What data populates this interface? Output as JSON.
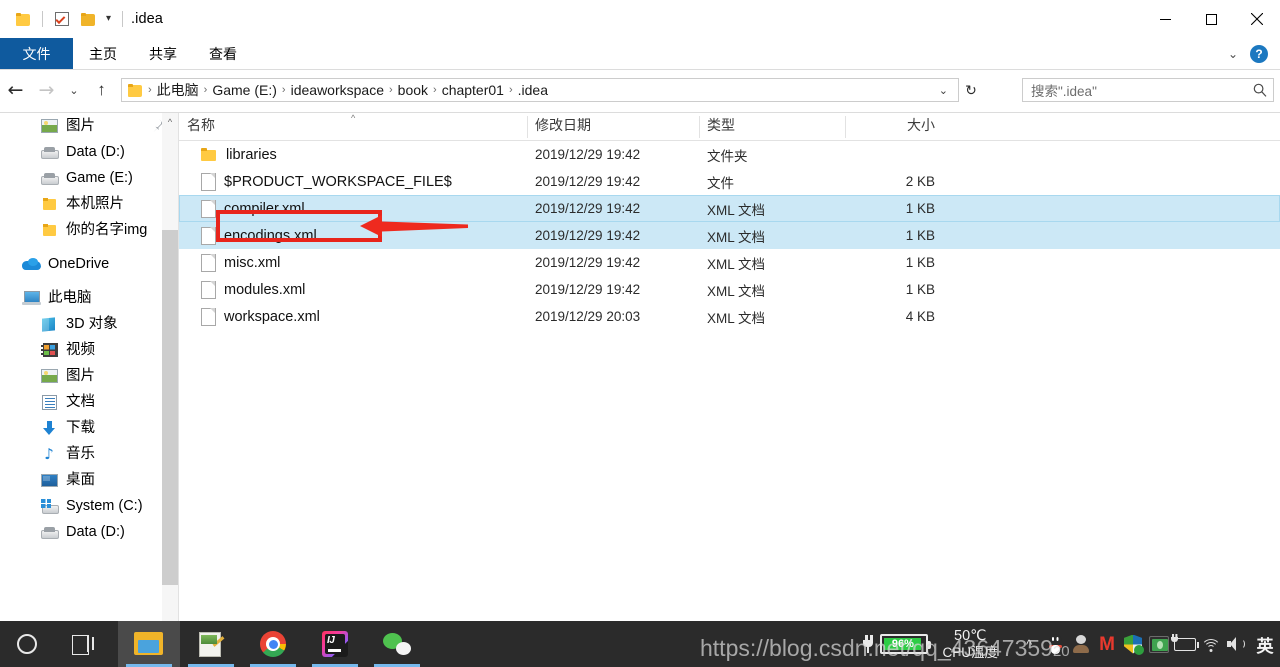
{
  "window": {
    "title": ".idea",
    "quick_access": [
      "folder-icon",
      "properties-checkbox-icon",
      "new-folder-icon",
      "customize-caret-icon"
    ],
    "controls": {
      "minimize": "–",
      "maximize": "□",
      "close": "×"
    }
  },
  "ribbon": {
    "tabs": [
      {
        "id": "file",
        "label": "文件"
      },
      {
        "id": "home",
        "label": "主页"
      },
      {
        "id": "share",
        "label": "共享"
      },
      {
        "id": "view",
        "label": "查看"
      }
    ],
    "active_tab": "file",
    "expand_caret": "⌄",
    "help_label": "?"
  },
  "navigation": {
    "back": "←",
    "forward": "→",
    "recent": "⌄",
    "up": "↑",
    "breadcrumb": [
      "此电脑",
      "Game (E:)",
      "ideaworkspace",
      "book",
      "chapter01",
      ".idea"
    ],
    "breadcrumb_separator": "›",
    "address_caret": "⌄",
    "refresh": "↻"
  },
  "search": {
    "placeholder": "搜索\".idea\"",
    "icon": "search-icon"
  },
  "sidebar": {
    "items": [
      {
        "label": "图片",
        "icon": "picture-icon",
        "indent": 1,
        "pinned": true
      },
      {
        "label": "Data (D:)",
        "icon": "drive-icon",
        "indent": 1,
        "pinned": false
      },
      {
        "label": "Game (E:)",
        "icon": "drive-icon",
        "indent": 1,
        "pinned": false
      },
      {
        "label": "本机照片",
        "icon": "folder-icon",
        "indent": 1,
        "pinned": false
      },
      {
        "label": "你的名字img",
        "icon": "folder-icon",
        "indent": 1,
        "pinned": false
      },
      {
        "label": "OneDrive",
        "icon": "onedrive-icon",
        "indent": 0,
        "pinned": false
      },
      {
        "label": "此电脑",
        "icon": "this-pc-icon",
        "indent": 0,
        "pinned": false
      },
      {
        "label": "3D 对象",
        "icon": "3d-objects-icon",
        "indent": 1,
        "pinned": false
      },
      {
        "label": "视频",
        "icon": "videos-icon",
        "indent": 1,
        "pinned": false
      },
      {
        "label": "图片",
        "icon": "pictures-icon",
        "indent": 1,
        "pinned": false
      },
      {
        "label": "文档",
        "icon": "documents-icon",
        "indent": 1,
        "pinned": false
      },
      {
        "label": "下载",
        "icon": "downloads-icon",
        "indent": 1,
        "pinned": false
      },
      {
        "label": "音乐",
        "icon": "music-icon",
        "indent": 1,
        "pinned": false
      },
      {
        "label": "桌面",
        "icon": "desktop-icon",
        "indent": 1,
        "pinned": false
      },
      {
        "label": "System (C:)",
        "icon": "system-drive-icon",
        "indent": 1,
        "pinned": false
      },
      {
        "label": "Data (D:)",
        "icon": "drive-icon",
        "indent": 1,
        "pinned": false
      }
    ],
    "scroll_up_glyph": "^"
  },
  "file_list": {
    "columns": [
      {
        "id": "name",
        "label": "名称"
      },
      {
        "id": "date",
        "label": "修改日期"
      },
      {
        "id": "type",
        "label": "类型"
      },
      {
        "id": "size",
        "label": "大小"
      }
    ],
    "sort_indicator": "^",
    "rows": [
      {
        "name": "libraries",
        "date": "2019/12/29 19:42",
        "type": "文件夹",
        "size": "",
        "icon": "folder-icon",
        "selected": false,
        "focused": false
      },
      {
        "name": "$PRODUCT_WORKSPACE_FILE$",
        "date": "2019/12/29 19:42",
        "type": "文件",
        "size": "2 KB",
        "icon": "file-icon",
        "selected": false,
        "focused": false
      },
      {
        "name": "compiler.xml",
        "date": "2019/12/29 19:42",
        "type": "XML 文档",
        "size": "1 KB",
        "icon": "file-icon",
        "selected": true,
        "focused": true
      },
      {
        "name": "encodings.xml",
        "date": "2019/12/29 19:42",
        "type": "XML 文档",
        "size": "1 KB",
        "icon": "file-icon",
        "selected": true,
        "focused": false
      },
      {
        "name": "misc.xml",
        "date": "2019/12/29 19:42",
        "type": "XML 文档",
        "size": "1 KB",
        "icon": "file-icon",
        "selected": false,
        "focused": false
      },
      {
        "name": "modules.xml",
        "date": "2019/12/29 19:42",
        "type": "XML 文档",
        "size": "1 KB",
        "icon": "file-icon",
        "selected": false,
        "focused": false
      },
      {
        "name": "workspace.xml",
        "date": "2019/12/29 20:03",
        "type": "XML 文档",
        "size": "4 KB",
        "icon": "file-icon",
        "selected": false,
        "focused": false
      }
    ]
  },
  "annotation": {
    "color": "#e8251c",
    "target_row": "compiler.xml",
    "shape": "rectangle-with-left-arrow"
  },
  "taskbar": {
    "start": "start-orb-icon",
    "cortana": "cortana-circle-icon",
    "task_view": "task-view-icon",
    "apps": [
      {
        "name": "file-explorer",
        "icon": "explorer-icon",
        "active": true,
        "running": true
      },
      {
        "name": "notepad-plus",
        "icon": "notepad-icon",
        "active": false,
        "running": true
      },
      {
        "name": "google-chrome",
        "icon": "chrome-icon",
        "active": false,
        "running": true
      },
      {
        "name": "intellij-idea",
        "icon": "intellij-idea-icon",
        "active": false,
        "running": true
      },
      {
        "name": "wechat",
        "icon": "wechat-icon",
        "active": false,
        "running": true
      }
    ],
    "tray": {
      "battery_percent": "96%",
      "cpu_temp_value": "50℃",
      "cpu_temp_label": "CPU温度",
      "chevron": "^",
      "icons": [
        "qq-icon",
        "head-icon",
        "m-icon",
        "security-shield-icon",
        "money-icon",
        "battery-icon",
        "wifi-icon",
        "volume-icon"
      ],
      "ime": "英"
    }
  },
  "watermark": {
    "text": "https://blog.csdn.net/qq_43647359",
    "tail": "20"
  }
}
